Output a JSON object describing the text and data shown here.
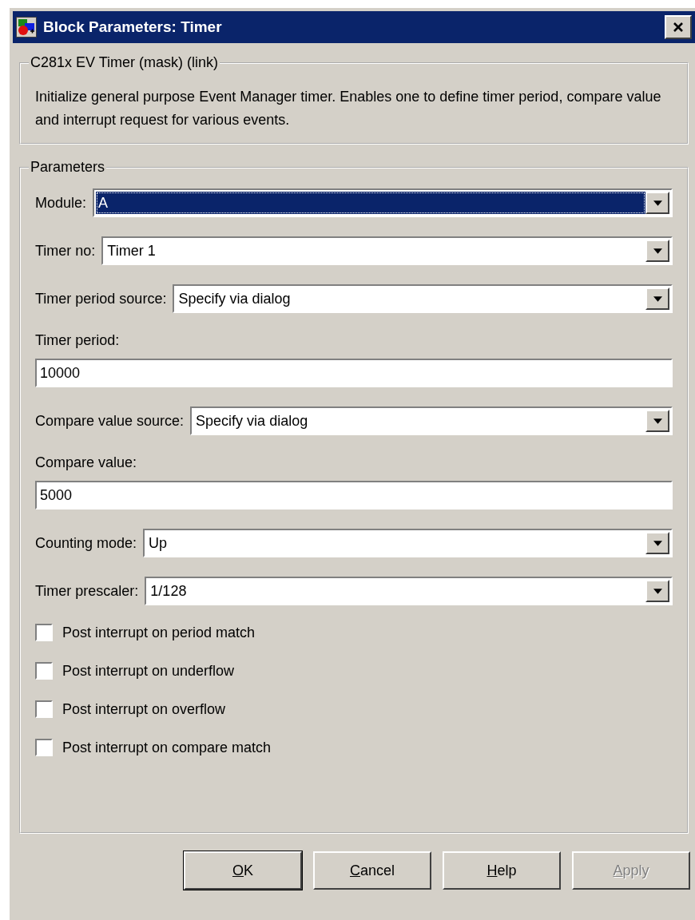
{
  "window": {
    "title": "Block Parameters: Timer"
  },
  "description_group": {
    "title": "C281x EV Timer (mask) (link)",
    "text": "Initialize general purpose Event Manager timer. Enables one to define timer period, compare value and interrupt request for various events."
  },
  "parameters_group": {
    "title": "Parameters",
    "items": [
      {
        "kind": "dropdown",
        "label": "Module:",
        "value": "A",
        "focused": true
      },
      {
        "kind": "dropdown",
        "label": "Timer no:",
        "value": "Timer 1",
        "focused": false
      },
      {
        "kind": "dropdown",
        "label": "Timer period source:",
        "value": "Specify via dialog",
        "focused": false
      },
      {
        "kind": "text",
        "label": "Timer period:",
        "value": "10000"
      },
      {
        "kind": "dropdown",
        "label": "Compare value source:",
        "value": "Specify via dialog",
        "focused": false
      },
      {
        "kind": "text",
        "label": "Compare value:",
        "value": "5000"
      },
      {
        "kind": "dropdown",
        "label": "Counting mode:",
        "value": "Up",
        "focused": false
      },
      {
        "kind": "dropdown",
        "label": "Timer prescaler:",
        "value": "1/128",
        "focused": false
      },
      {
        "kind": "checkbox",
        "label": "Post interrupt on period match",
        "checked": false
      },
      {
        "kind": "checkbox",
        "label": "Post interrupt on underflow",
        "checked": false
      },
      {
        "kind": "checkbox",
        "label": "Post interrupt on overflow",
        "checked": false
      },
      {
        "kind": "checkbox",
        "label": "Post interrupt on compare match",
        "checked": false
      }
    ]
  },
  "buttons": [
    {
      "mnemonic": "O",
      "rest": "K",
      "default": true,
      "disabled": false
    },
    {
      "mnemonic": "C",
      "rest": "ancel",
      "default": false,
      "disabled": false
    },
    {
      "mnemonic": "H",
      "rest": "elp",
      "default": false,
      "disabled": false
    },
    {
      "mnemonic": "A",
      "rest": "pply",
      "default": false,
      "disabled": true
    }
  ]
}
